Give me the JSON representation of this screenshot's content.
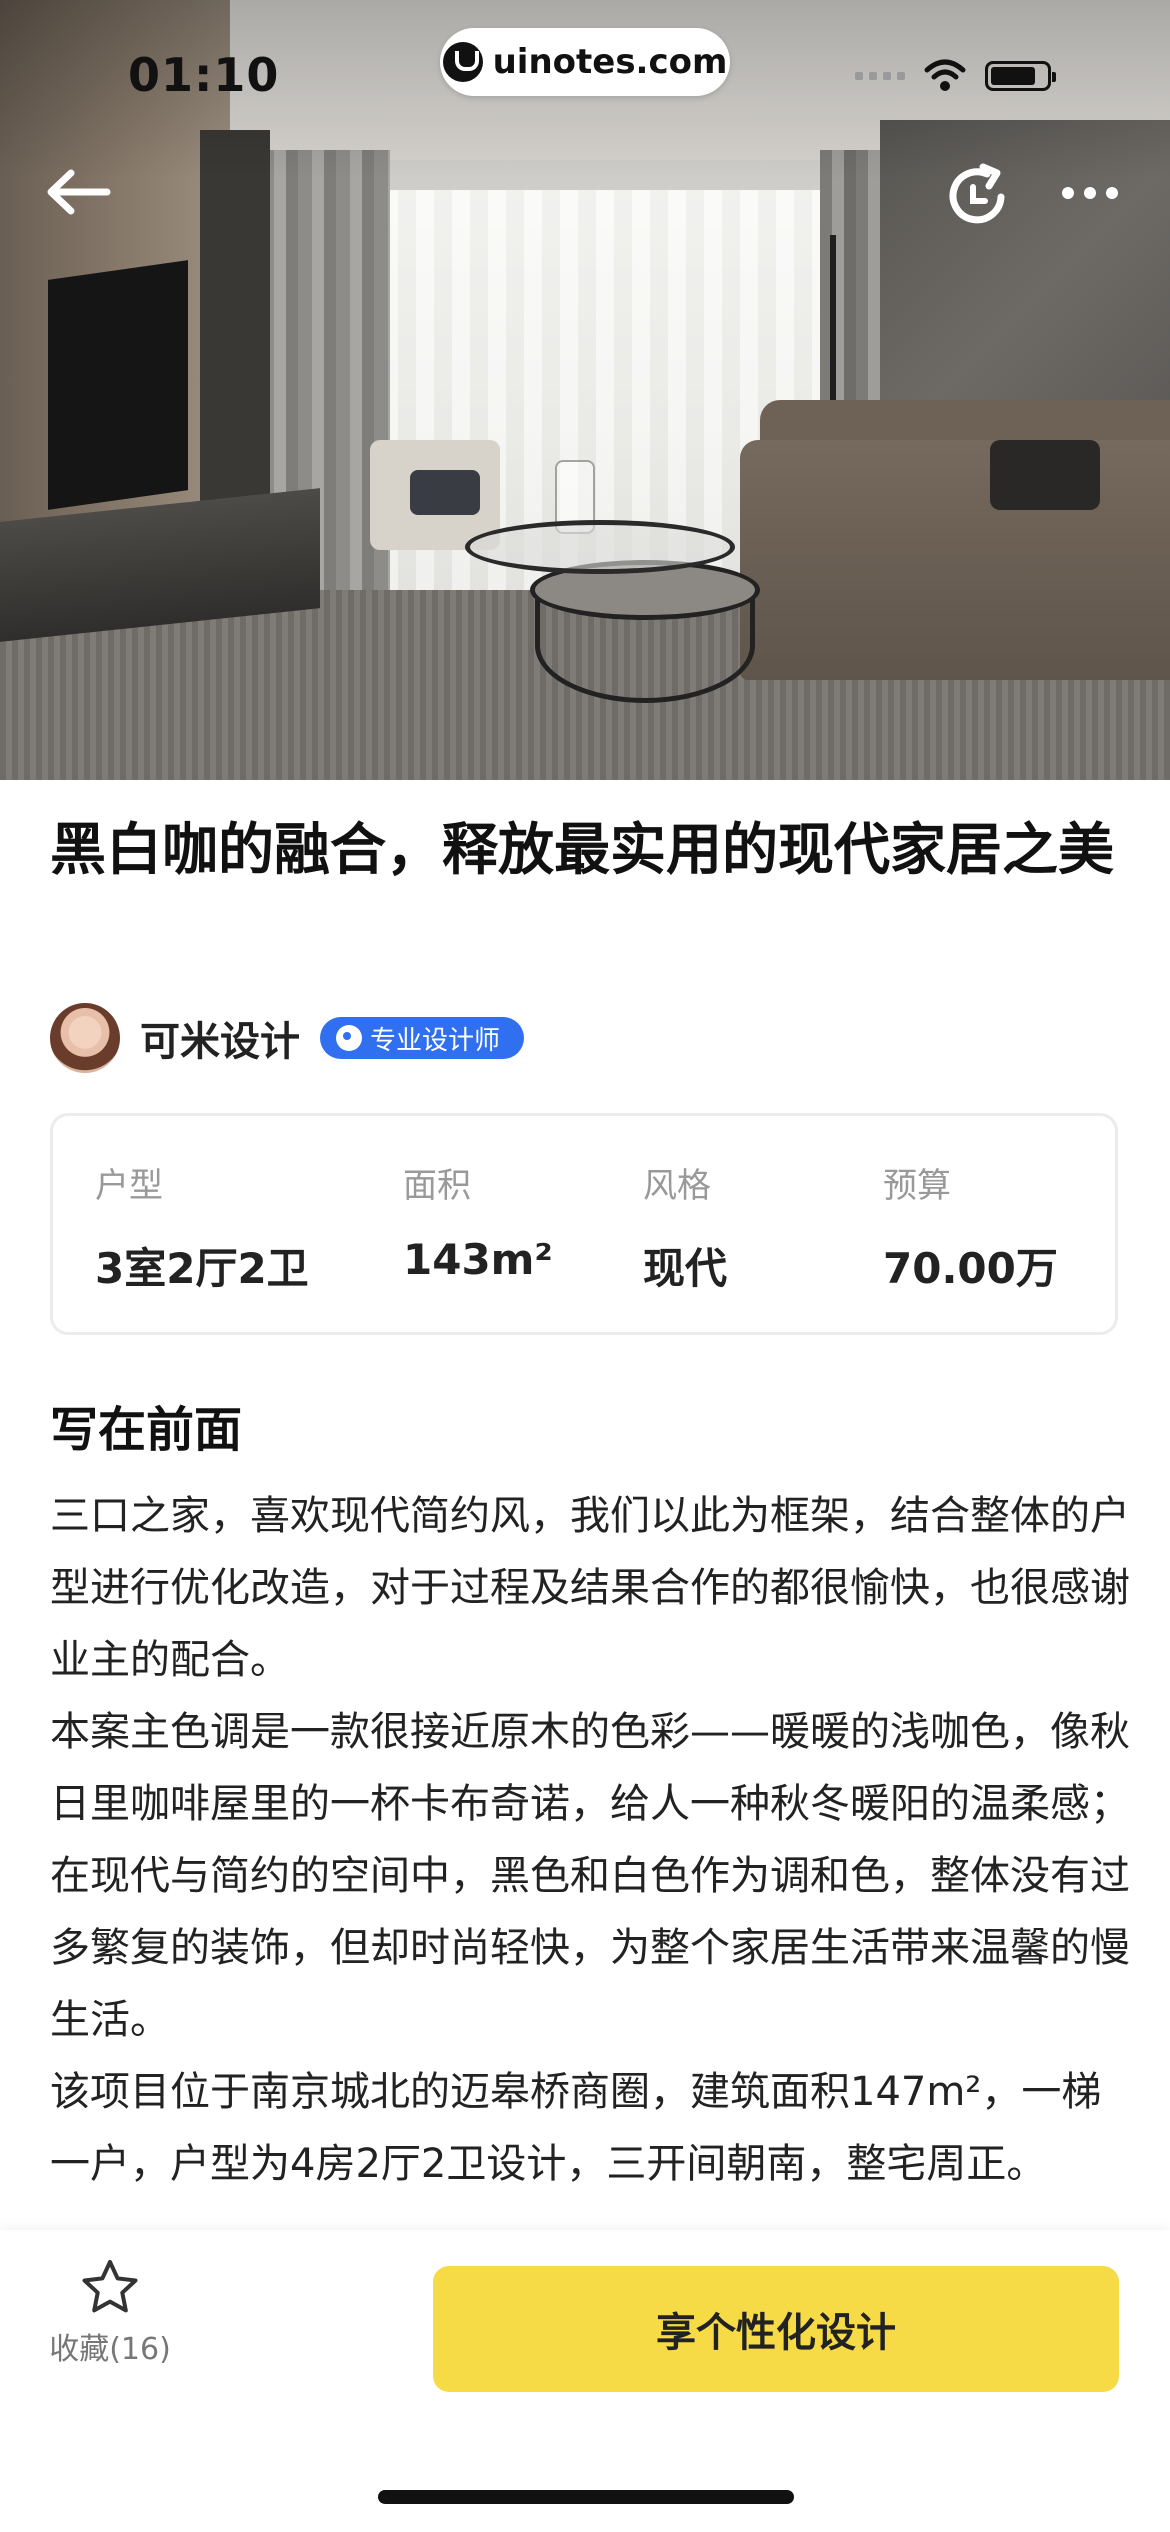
{
  "status_bar": {
    "time": "01:10",
    "url": "uinotes.com",
    "signal_icon": "signal-icon",
    "wifi_icon": "wifi-icon",
    "battery_icon": "battery-icon"
  },
  "nav": {
    "back_icon": "arrow-left-icon",
    "refresh_icon": "refresh-icon",
    "more_icon": "more-dots-icon"
  },
  "article": {
    "title": "黑白咖的融合，释放最实用的现代家居之美",
    "author": {
      "name": "可米设计",
      "badge": "专业设计师"
    },
    "info": [
      {
        "label": "户型",
        "value": "3室2厅2卫"
      },
      {
        "label": "面积",
        "value": "143m²"
      },
      {
        "label": "风格",
        "value": "现代"
      },
      {
        "label": "预算",
        "value": "70.00万"
      }
    ],
    "section_title": "写在前面",
    "paragraphs": [
      "三口之家，喜欢现代简约风，我们以此为框架，结合整体的户型进行优化改造，对于过程及结果合作的都很愉快，也很感谢业主的配合。",
      "本案主色调是一款很接近原木的色彩——暖暖的浅咖色，像秋日里咖啡屋里的一杯卡布奇诺，给人一种秋冬暖阳的温柔感；在现代与简约的空间中，黑色和白色作为调和色，整体没有过多繁复的装饰，但却时尚轻快，为整个家居生活带来温馨的慢生活。",
      "该项目位于南京城北的迈皋桥商圈，建筑面积147m²，一梯一户，户型为4房2厅2卫设计，三开间朝南，整宅周正。"
    ]
  },
  "bottom_bar": {
    "favorite_label": "收藏(16)",
    "favorite_icon": "star-outline-icon",
    "cta_label": "享个性化设计"
  },
  "colors": {
    "accent": "#f6db46",
    "badge_blue": "#2f6ff0"
  }
}
